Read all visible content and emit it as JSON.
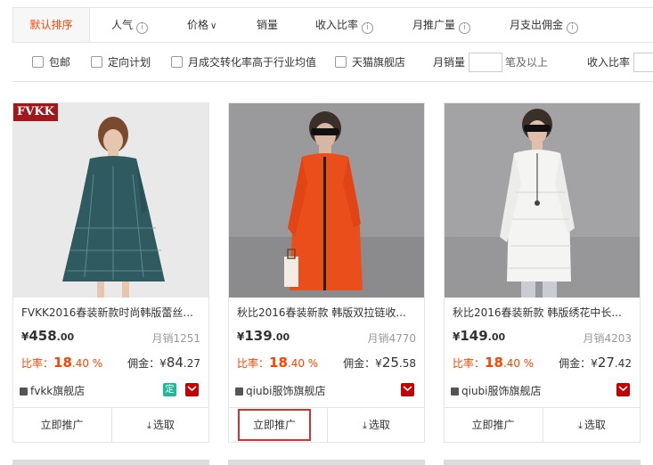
{
  "sort": {
    "items": [
      {
        "label": "默认排序",
        "active": true,
        "info": false,
        "arrow": false
      },
      {
        "label": "人气",
        "info": true
      },
      {
        "label": "价格",
        "arrow": true
      },
      {
        "label": "销量"
      },
      {
        "label": "收入比率",
        "info": true
      },
      {
        "label": "月推广量",
        "info": true
      },
      {
        "label": "月支出佣金",
        "info": true
      }
    ]
  },
  "filters": {
    "free_shipping": "包邮",
    "targeted_plan": "定向计划",
    "conversion_above": "月成交转化率高于行业均值",
    "tmall_store": "天猫旗舰店",
    "monthly_sales_label": "月销量",
    "monthly_sales_suffix": "笔及以上",
    "income_ratio_label": "收入比率"
  },
  "icons": {
    "info": "ⓘ",
    "chevron": "⌵",
    "download": "⤓"
  },
  "colors": {
    "accent": "#ff4400",
    "tmall": "#c40000",
    "ding": "#1fb89a",
    "highlight": "#d9302f"
  },
  "products": [
    {
      "brand_tag": "FVKK",
      "title": "FVKK2016春装新款时尚韩版蕾丝...",
      "price_int": "458",
      "price_dec": ".00",
      "currency": "¥",
      "sales": "月销1251",
      "ratio_label": "比率：",
      "ratio_int": "18",
      "ratio_dec": ".40 %",
      "commission_label": "佣金：",
      "commission_int": "84",
      "commission_dec": ".27",
      "store": "fvkk旗舰店",
      "ding_badge": "定",
      "promote": "立即推广",
      "select": "选取"
    },
    {
      "title": "秋比2016春装新款 韩版双拉链收...",
      "price_int": "139",
      "price_dec": ".00",
      "currency": "¥",
      "sales": "月销4770",
      "ratio_label": "比率：",
      "ratio_int": "18",
      "ratio_dec": ".40 %",
      "commission_label": "佣金：",
      "commission_int": "25",
      "commission_dec": ".58",
      "store": "qiubi服饰旗舰店",
      "promote": "立即推广",
      "select": "选取"
    },
    {
      "title": "秋比2016春装新款 韩版绣花中长...",
      "price_int": "149",
      "price_dec": ".00",
      "currency": "¥",
      "sales": "月销4203",
      "ratio_label": "比率：",
      "ratio_int": "18",
      "ratio_dec": ".40 %",
      "commission_label": "佣金：",
      "commission_int": "27",
      "commission_dec": ".42",
      "store": "qiubi服饰旗舰店",
      "promote": "立即推广",
      "select": "选取"
    }
  ]
}
